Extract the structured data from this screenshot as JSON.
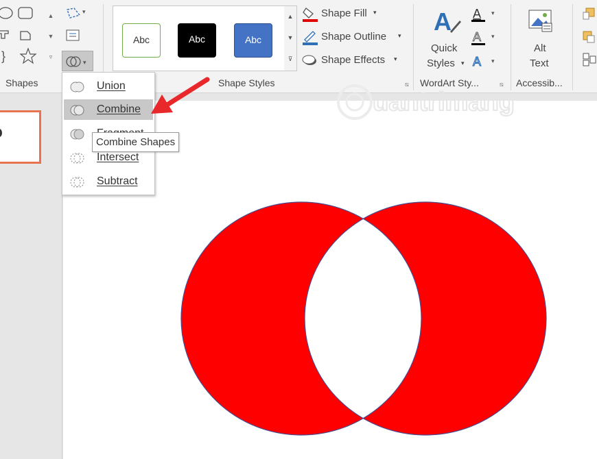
{
  "ribbon": {
    "groups": {
      "shapes": "Shapes",
      "shape_styles": "Shape Styles",
      "wordart": "WordArt Sty...",
      "accessibility": "Accessib..."
    },
    "style_samples": [
      "Abc",
      "Abc",
      "Abc"
    ],
    "shape_fill": "Shape Fill",
    "shape_outline": "Shape Outline",
    "shape_effects": "Shape Effects",
    "quick_styles_line1": "Quick",
    "quick_styles_line2": "Styles",
    "alt_text_line1": "Alt",
    "alt_text_line2": "Text"
  },
  "merge_menu": {
    "items": [
      {
        "label": "Union",
        "icon": "union-icon"
      },
      {
        "label": "Combine",
        "icon": "combine-icon",
        "highlighted": true
      },
      {
        "label": "Fragment",
        "icon": "fragment-icon"
      },
      {
        "label": "Intersect",
        "icon": "intersect-icon"
      },
      {
        "label": "Subtract",
        "icon": "subtract-icon"
      }
    ],
    "tooltip": "Combine Shapes"
  },
  "watermark": "uantrimang",
  "colors": {
    "accent_red": "#ff0000",
    "arrow_red": "#e8282a",
    "thumb_border": "#e8734f",
    "style_blue": "#4472c4",
    "style_green_border": "#70ad47"
  }
}
